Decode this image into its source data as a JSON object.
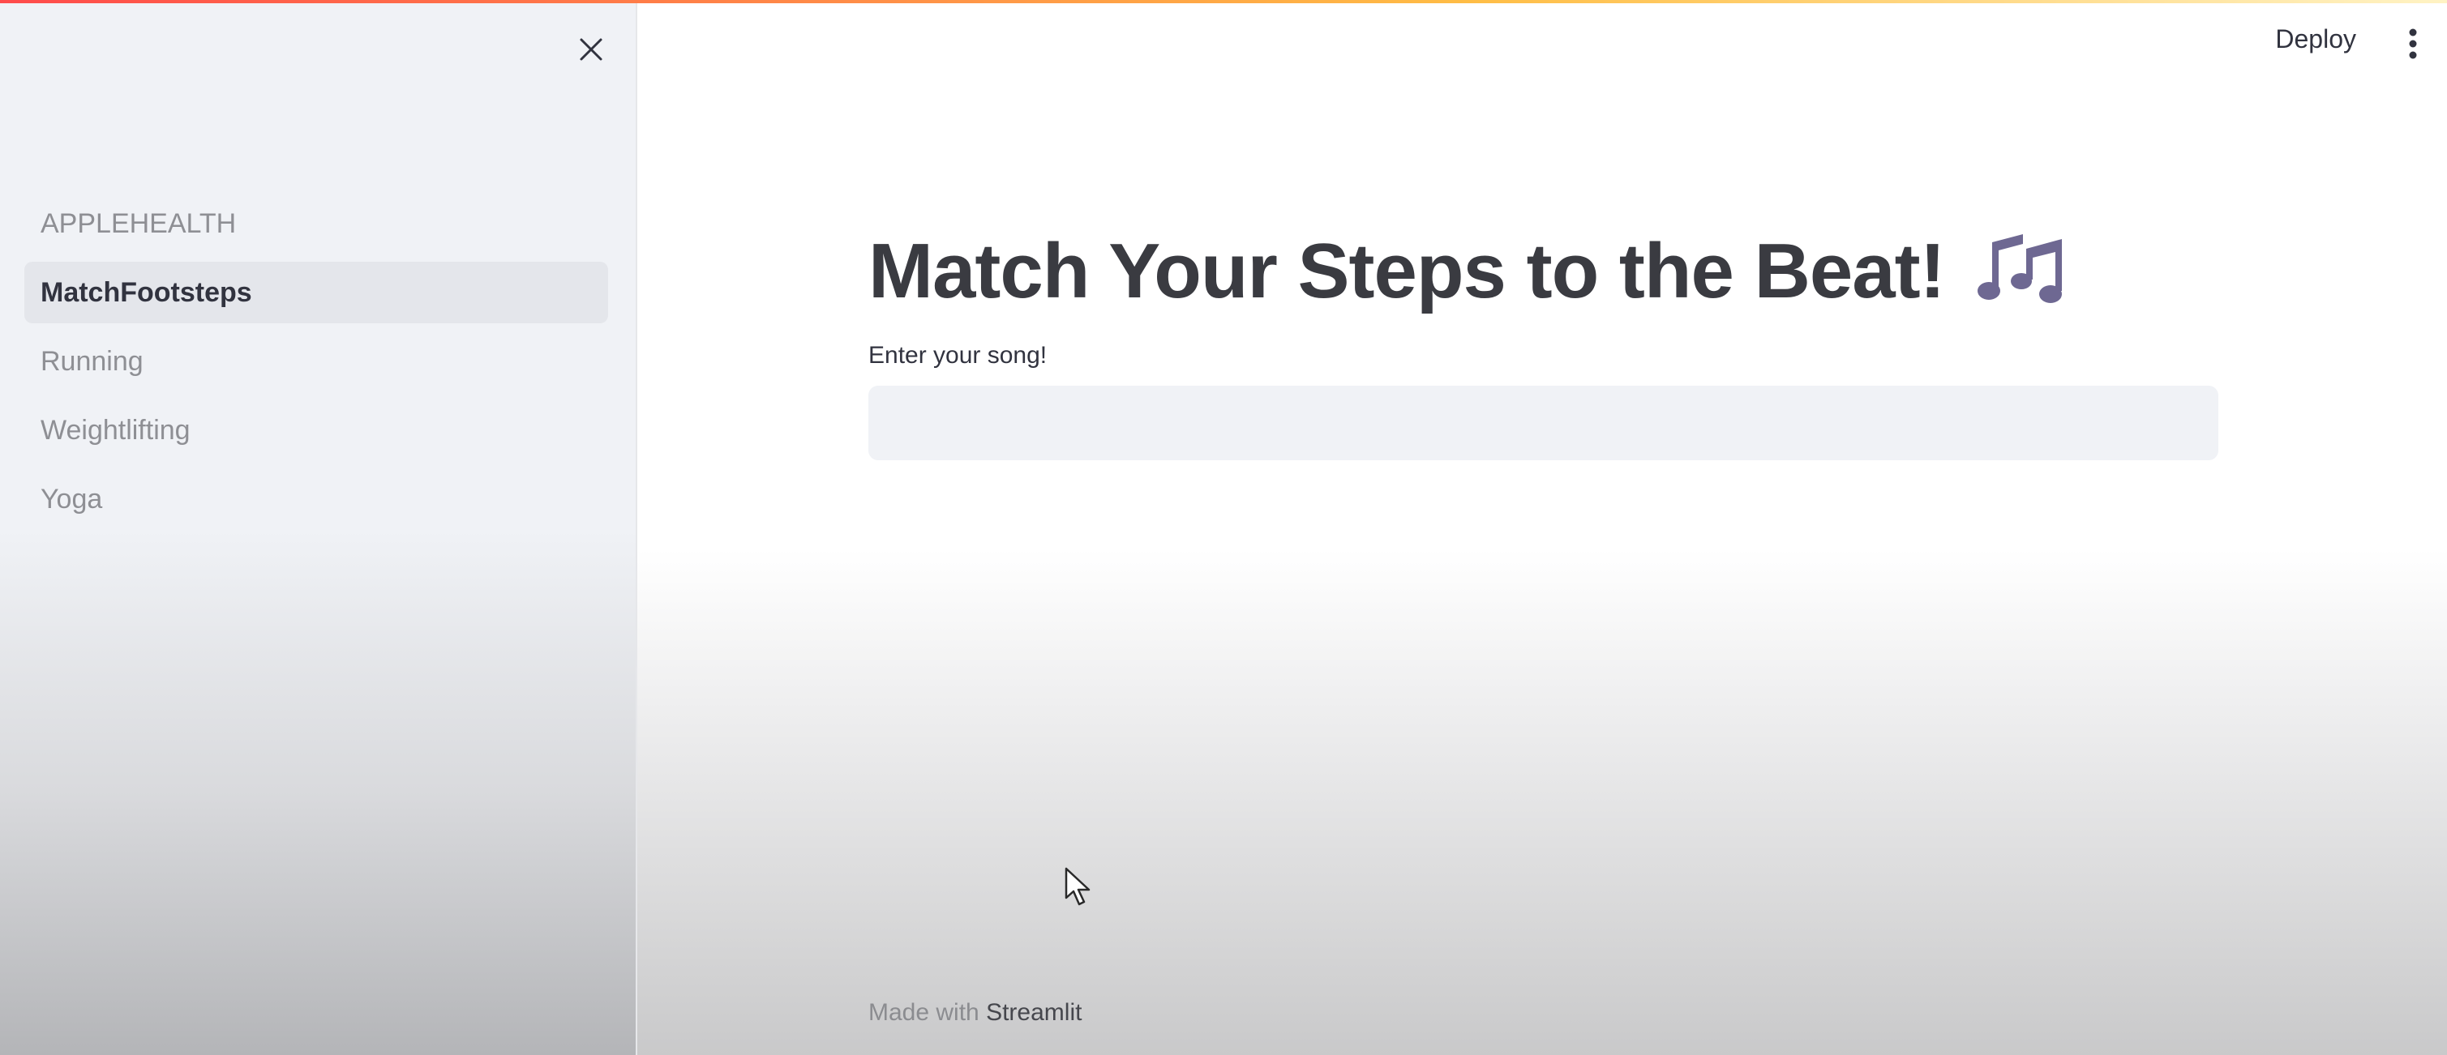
{
  "sidebar": {
    "close_icon": "close-icon",
    "items": [
      {
        "label": "APPLEHEALTH",
        "active": false
      },
      {
        "label": "MatchFootsteps",
        "active": true
      },
      {
        "label": "Running",
        "active": false
      },
      {
        "label": "Weightlifting",
        "active": false
      },
      {
        "label": "Yoga",
        "active": false
      }
    ]
  },
  "header": {
    "deploy_label": "Deploy",
    "menu_icon": "vertical-ellipsis-icon"
  },
  "main": {
    "title": "Match Your Steps to the Beat!",
    "title_emoji": "music-notes-icon",
    "input_label": "Enter your song!",
    "input_value": "",
    "input_placeholder": ""
  },
  "footer": {
    "made_with": "Made with",
    "brand": "Streamlit"
  },
  "colors": {
    "accent_gradient_start": "#ff4b4b",
    "accent_gradient_end": "#ffbd45",
    "sidebar_bg": "#f0f2f6",
    "text_primary": "#31333f",
    "text_muted": "#8e8f94",
    "emoji_purple": "#6e6892"
  }
}
